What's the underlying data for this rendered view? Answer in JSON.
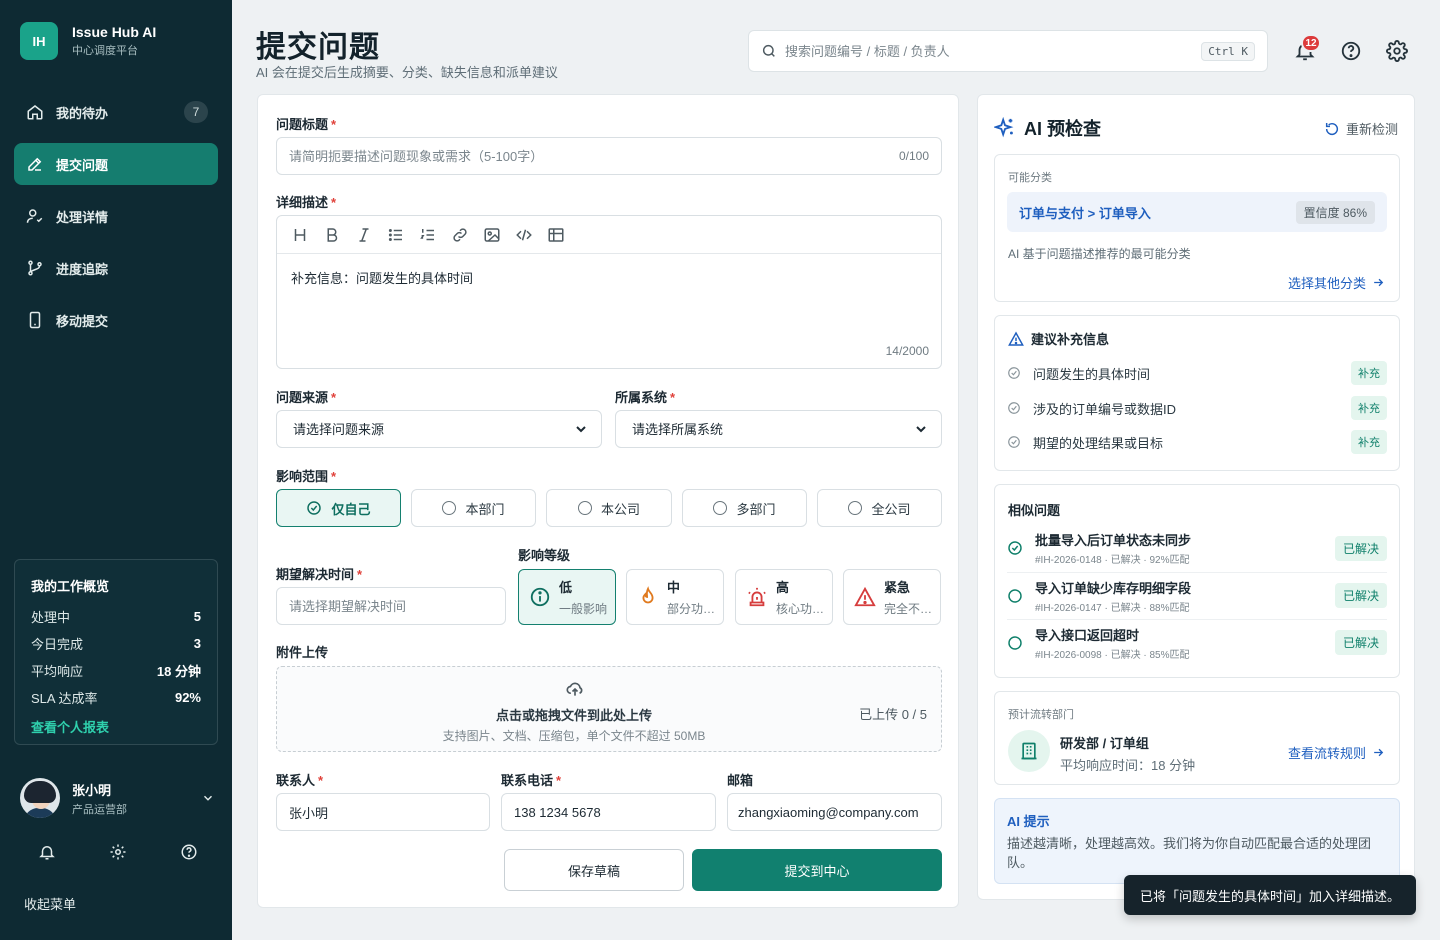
{
  "brand": {
    "logo": "IH",
    "name": "Issue Hub AI",
    "subtitle": "中心调度平台"
  },
  "nav": [
    {
      "label": "我的待办",
      "icon": "home-icon",
      "badge": "7",
      "active": false
    },
    {
      "label": "提交问题",
      "icon": "pen-icon",
      "active": true
    },
    {
      "label": "处理详情",
      "icon": "user-check-icon",
      "active": false
    },
    {
      "label": "进度追踪",
      "icon": "branch-icon",
      "active": false
    },
    {
      "label": "移动提交",
      "icon": "mobile-icon",
      "active": false
    }
  ],
  "overview": {
    "title": "我的工作概览",
    "rows": [
      {
        "label": "处理中",
        "value": "5"
      },
      {
        "label": "今日完成",
        "value": "3"
      },
      {
        "label": "平均响应",
        "value": "18 分钟"
      },
      {
        "label": "SLA 达成率",
        "value": "92%"
      }
    ],
    "link": "查看个人报表"
  },
  "user": {
    "name": "张小明",
    "dept": "产品运营部"
  },
  "collapse_label": "收起菜单",
  "header": {
    "title": "提交问题",
    "subtitle": "AI 会在提交后生成摘要、分类、缺失信息和派单建议",
    "search_placeholder": "搜索问题编号 / 标题 / 负责人",
    "search_shortcut": "Ctrl K",
    "notification_count": "12"
  },
  "form": {
    "title_label": "问题标题",
    "title_placeholder": "请简明扼要描述问题现象或需求（5-100字）",
    "title_counter": "0/100",
    "desc_label": "详细描述",
    "desc_text": "补充信息：问题发生的具体时间",
    "desc_counter": "14/2000",
    "source_label": "问题来源",
    "source_value": "请选择问题来源",
    "system_label": "所属系统",
    "system_value": "请选择所属系统",
    "scope_label": "影响范围",
    "scope_options": [
      "仅自己",
      "本部门",
      "本公司",
      "多部门",
      "全公司"
    ],
    "scope_selected": "仅自己",
    "expected_label": "期望解决时间",
    "expected_placeholder": "请选择期望解决时间",
    "level_label": "影响等级",
    "levels": [
      {
        "title": "低",
        "desc": "一般影响",
        "active": true
      },
      {
        "title": "中",
        "desc": "部分功能受影响",
        "active": false
      },
      {
        "title": "高",
        "desc": "核心功能受影响",
        "active": false
      },
      {
        "title": "紧急",
        "desc": "完全不可用",
        "active": false
      }
    ],
    "upload_label": "附件上传",
    "upload_main": "点击或拖拽文件到此处上传",
    "upload_sub": "支持图片、文档、压缩包，单个文件不超过 50MB",
    "upload_count": "已上传 0 / 5",
    "contact_label": "联系人",
    "contact_value": "张小明",
    "phone_label": "联系电话",
    "phone_value": "138 1234 5678",
    "email_label": "邮箱",
    "email_value": "zhangxiaoming@company.com",
    "draft_button": "保存草稿",
    "submit_button": "提交到中心"
  },
  "ai": {
    "title": "AI 预检查",
    "recheck": "重新检测",
    "category_caption": "可能分类",
    "category_path": "订单与支付 > 订单导入",
    "confidence": "置信度 86%",
    "category_note": "AI 基于问题描述推荐的最可能分类",
    "category_link": "选择其他分类",
    "suggest_title": "建议补充信息",
    "suggestions": [
      "问题发生的具体时间",
      "涉及的订单编号或数据ID",
      "期望的处理结果或目标"
    ],
    "suggest_tag": "补充",
    "similar_title": "相似问题",
    "similar": [
      {
        "title": "批量导入后订单状态未同步",
        "meta": "#IH-2026-0148 · 已解决 · 92%匹配",
        "status": "已解决",
        "checked": true
      },
      {
        "title": "导入订单缺少库存明细字段",
        "meta": "#IH-2026-0147 · 已解决 · 88%匹配",
        "status": "已解决",
        "checked": false
      },
      {
        "title": "导入接口返回超时",
        "meta": "#IH-2026-0098 · 已解决 · 85%匹配",
        "status": "已解决",
        "checked": false
      }
    ],
    "route_caption": "预计流转部门",
    "route_dept": "研发部 / 订单组",
    "route_time": "平均响应时间：18 分钟",
    "route_link": "查看流转规则",
    "tip_title": "AI 提示",
    "tip_text": "描述越清晰，处理越高效。我们将为你自动匹配最合适的处理团队。"
  },
  "toast": "已将「问题发生的具体时间」加入详细描述。",
  "colors": {
    "brand": "#11806f",
    "sidebar": "#0e2a33",
    "link": "#1f5fbf",
    "danger": "#dc3b3b"
  }
}
